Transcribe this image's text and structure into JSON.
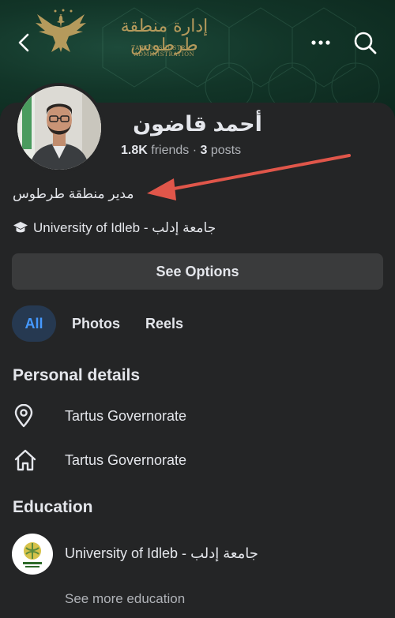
{
  "cover": {
    "title_ar": "إدارة منطقة طرطوس",
    "subtitle": "TARTOUS DISTRICT ADMINISTRATION"
  },
  "nav": {
    "back_icon": "chevron-left-icon",
    "more_icon": "ellipsis-icon",
    "search_icon": "search-icon"
  },
  "profile": {
    "name": "أحمد قاضون",
    "friends_count": "1.8K",
    "friends_label": "friends",
    "separator": "·",
    "posts_count": "3",
    "posts_label": "posts",
    "bio": "مدير منطقة طرطوس",
    "education_line": "جامعة إدلب - University of Idleb"
  },
  "actions": {
    "see_options": "See Options"
  },
  "tabs": [
    {
      "label": "All",
      "active": true
    },
    {
      "label": "Photos",
      "active": false
    },
    {
      "label": "Reels",
      "active": false
    }
  ],
  "personal_details": {
    "title": "Personal details",
    "items": [
      {
        "icon": "location-pin-icon",
        "text": "Tartus Governorate"
      },
      {
        "icon": "home-icon",
        "text": "Tartus Governorate"
      }
    ]
  },
  "education": {
    "title": "Education",
    "school": "University of Idleb - جامعة إدلب",
    "logo_text": "جامعة إدلب",
    "see_more": "See more education"
  },
  "colors": {
    "background": "#242526",
    "button": "#3a3b3c",
    "accent": "#4599ff",
    "active_tab_bg": "#263951",
    "arrow": "#e0564a",
    "cover_gold": "#b59a5c"
  }
}
